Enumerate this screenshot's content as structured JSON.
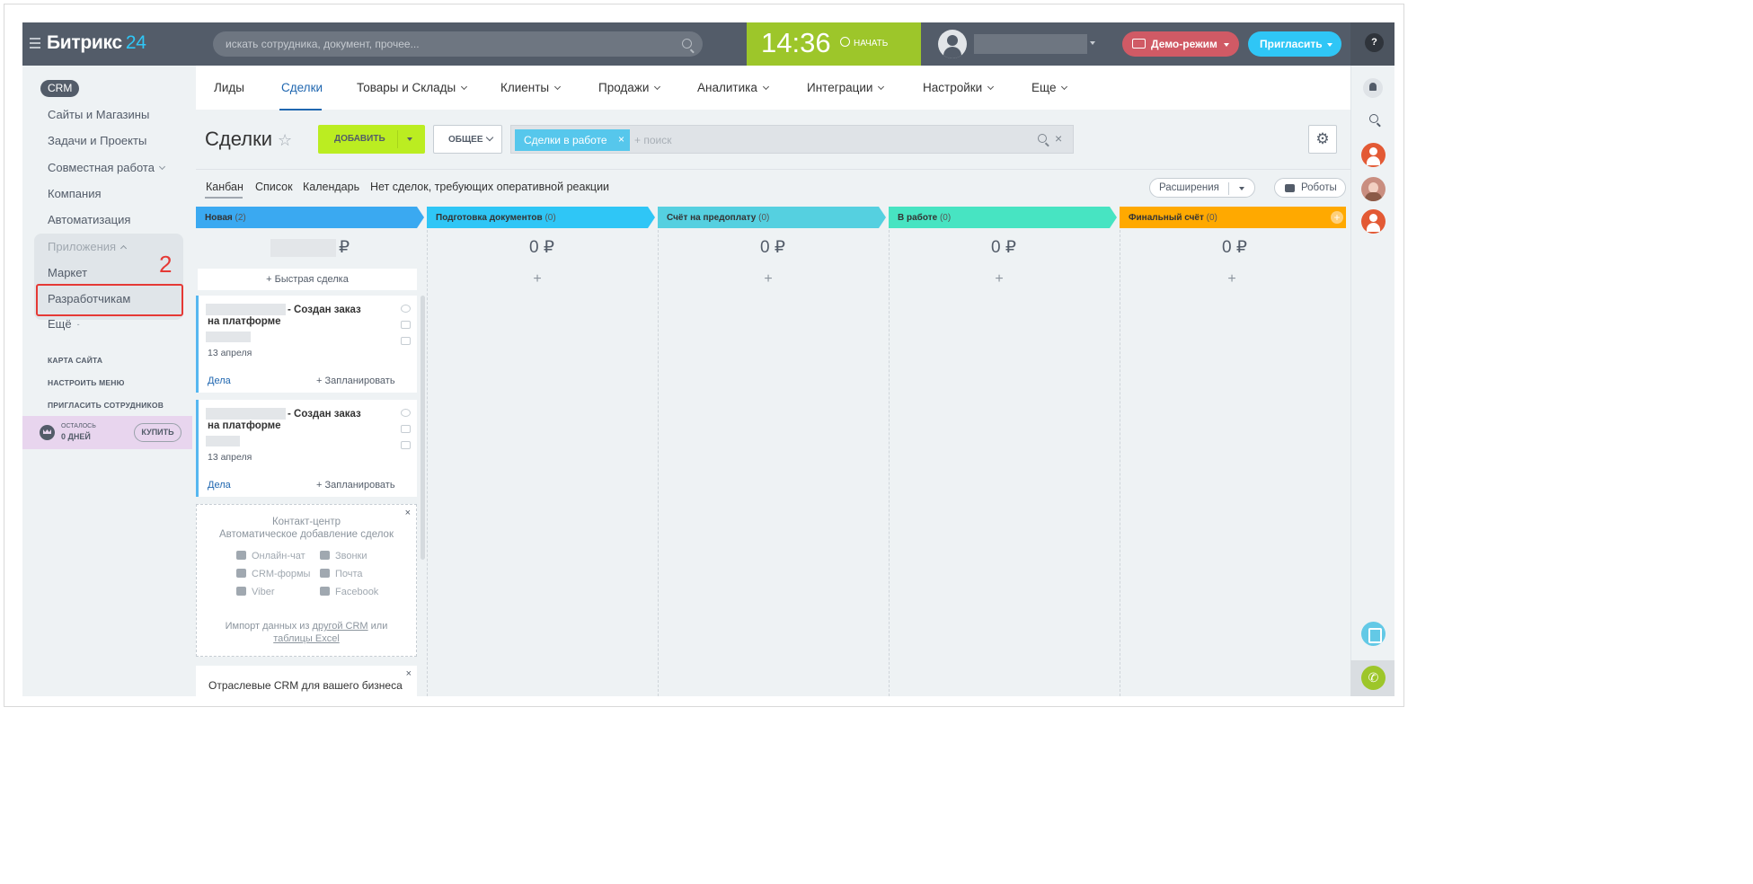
{
  "header": {
    "logo_main": "Битрикс",
    "logo_suffix": "24",
    "search_placeholder": "искать сотрудника, документ, прочее...",
    "time": "14:36",
    "start_label": "НАЧАТЬ",
    "demo_label": "Демо-режим",
    "invite_label": "Пригласить",
    "help_label": "?"
  },
  "sidebar": {
    "section": "CRM",
    "items": [
      {
        "label": "Сайты и Магазины"
      },
      {
        "label": "Задачи и Проекты"
      },
      {
        "label": "Совместная работа"
      },
      {
        "label": "Компания"
      },
      {
        "label": "Автоматизация"
      }
    ],
    "apps_group": {
      "label": "Приложения",
      "items": [
        {
          "label": "Маркет"
        },
        {
          "label": "Разработчикам"
        }
      ]
    },
    "more": "Ещё",
    "annotation": "2",
    "small_links": [
      "КАРТА САЙТА",
      "НАСТРОИТЬ МЕНЮ",
      "ПРИГЛАСИТЬ СОТРУДНИКОВ"
    ],
    "trial": {
      "left_label": "ОСТАЛОСЬ",
      "days": "0 ДНЕЙ",
      "buy": "КУПИТЬ"
    }
  },
  "topnav": {
    "tabs": [
      {
        "label": "Лиды"
      },
      {
        "label": "Сделки"
      },
      {
        "label": "Товары и Склады"
      },
      {
        "label": "Клиенты"
      },
      {
        "label": "Продажи"
      },
      {
        "label": "Аналитика"
      },
      {
        "label": "Интеграции"
      },
      {
        "label": "Настройки"
      },
      {
        "label": "Еще"
      }
    ]
  },
  "toolbar": {
    "title": "Сделки",
    "add_label": "ДОБАВИТЬ",
    "general_label": "ОБЩЕЕ",
    "filter_chip": "Сделки в работе",
    "filter_chip_close": "×",
    "filter_placeholder": "+ поиск",
    "filter_clear": "×",
    "settings_icon": "⚙"
  },
  "views": {
    "tabs": [
      "Канбан",
      "Список",
      "Календарь",
      "Нет сделок, требующих оперативной реакции"
    ],
    "extensions_label": "Расширения",
    "robots_label": "Роботы"
  },
  "kanban": {
    "columns": [
      {
        "title": "Новая",
        "count": "(2)",
        "sum": "₽",
        "color": "#3aa9f1"
      },
      {
        "title": "Подготовка документов",
        "count": "(0)",
        "sum": "0 ₽",
        "color": "#2fc6f6"
      },
      {
        "title": "Счёт на предоплату",
        "count": "(0)",
        "sum": "0 ₽",
        "color": "#55d0e0"
      },
      {
        "title": "В работе",
        "count": "(0)",
        "sum": "0 ₽",
        "color": "#47e4c2"
      },
      {
        "title": "Финальный счёт",
        "count": "(0)",
        "sum": "0 ₽",
        "color": "#ffa900"
      }
    ],
    "quick_deal": "+ Быстрая сделка",
    "plus": "+",
    "cards": [
      {
        "title": "- Создан заказ на платформе",
        "date": "13 апреля",
        "deals": "Дела",
        "plan": "+ Запланировать"
      },
      {
        "title": "- Создан заказ на платформе",
        "date": "13 апреля",
        "deals": "Дела",
        "plan": "+ Запланировать"
      }
    ],
    "contact_center": {
      "title": "Контакт-центр",
      "subtitle": "Автоматическое добавление сделок",
      "channels": [
        "Онлайн-чат",
        "Звонки",
        "CRM-формы",
        "Почта",
        "Viber",
        "Facebook"
      ],
      "import_prefix": "Импорт данных из",
      "import_link1": "другой CRM",
      "import_middle": "или",
      "import_link2": "таблицы Excel",
      "close": "×"
    },
    "industry": {
      "title": "Отраслевые CRM для вашего бизнеса",
      "close": "×"
    }
  }
}
